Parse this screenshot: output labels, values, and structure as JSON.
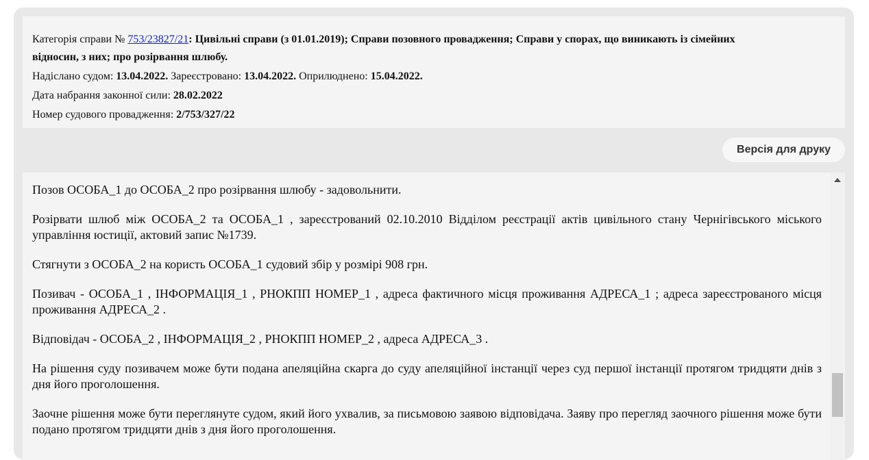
{
  "case_info": {
    "category_label": "Категорія справи №",
    "case_number": "753/23827/21",
    "category_text": ": Цивільні справи (з 01.01.2019); Справи позовного провадження; Справи у спорах, що виникають із сімейних",
    "category_text_2": "відносин, з них; про розірвання шлюбу.",
    "sent_label": "Надіслано судом:",
    "sent_date": "13.04.2022.",
    "registered_label": "Зареєстровано:",
    "registered_date": "13.04.2022.",
    "published_label": "Оприлюднено:",
    "published_date": "15.04.2022.",
    "effective_label": "Дата набрання законної сили:",
    "effective_date": "28.02.2022",
    "proceeding_label": "Номер судового провадження:",
    "proceeding_number": "2/753/327/22"
  },
  "toolbar": {
    "print_label": "Версія для друку"
  },
  "document": {
    "paragraphs": [
      "Позов   ОСОБА_1 до  ОСОБА_2 про розірвання шлюбу - задовольнити.",
      "Розірвати шлюб між ОСОБА_2 та ОСОБА_1 , зареєстрований 02.10.2010 Відділом реєстрації актів цивільного стану Чернігівського міського управління юстиції, актовий запис №1739.",
      "Стягнути з ОСОБА_2 на користь ОСОБА_1 судовий збір у розмірі 908 грн.",
      "Позивач - ОСОБА_1 , ІНФОРМАЦІЯ_1 , РНОКПП НОМЕР_1 , адреса фактичного місця проживання АДРЕСА_1 ; адреса зареєстрованого місця проживання АДРЕСА_2 .",
      "Відповідач - ОСОБА_2 , ІНФОРМАЦІЯ_2 , РНОКПП НОМЕР_2 , адреса АДРЕСА_3 .",
      "На рішення суду позивачем може бути подана апеляційна скарга до суду апеляційної інстанції через суд першої інстанції протягом тридцяти днів з дня його проголошення.",
      "Заочне рішення може бути переглянуте судом, який його ухвалив, за письмовою заявою відповідача. Заяву про перегляд заочного рішення може бути подано протягом тридцяти днів з дня його проголошення."
    ]
  },
  "colors": {
    "link": "#0a1fd6",
    "panel_bg": "#f4f4f4",
    "outer_bg": "#e8e8e8"
  }
}
